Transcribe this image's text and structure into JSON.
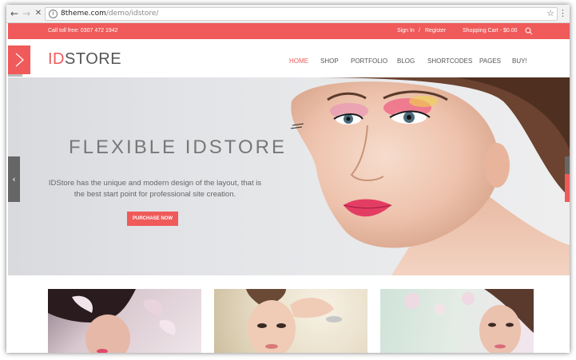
{
  "browser": {
    "url_host": "8theme.com",
    "url_path": "/demo/idstore/",
    "info_glyph": "i",
    "back_glyph": "←",
    "forward_glyph": "→",
    "stop_glyph": "✕",
    "star_glyph": "☆",
    "menu_glyph": "⋮"
  },
  "topbar": {
    "phone": "Call toll free: 0307 472 1942",
    "sign_in": "Sign In",
    "separator": "/",
    "register": "Register",
    "cart": "Shopping Cart - $0.00",
    "accent": "#f05a5a"
  },
  "header": {
    "logo_accent": "ID",
    "logo_rest": "STORE",
    "nav": [
      {
        "label": "HOME",
        "active": true
      },
      {
        "label": "SHOP"
      },
      {
        "label": "PORTFOLIO"
      },
      {
        "label": "BLOG"
      },
      {
        "label": "SHORTCODES"
      },
      {
        "label": "PAGES"
      },
      {
        "label": "BUY!"
      }
    ]
  },
  "hero": {
    "title": "FLEXIBLE  IDSTORE",
    "description": "IDStore has the unique and modern design of the layout, that is the best start point for professional site creation.",
    "cta": "PURCHASE NOW",
    "prev_glyph": "‹"
  },
  "icons": {
    "menu_toggle": "chevron-right-icon",
    "search": "search-icon",
    "slider_prev": "chevron-left-icon"
  }
}
